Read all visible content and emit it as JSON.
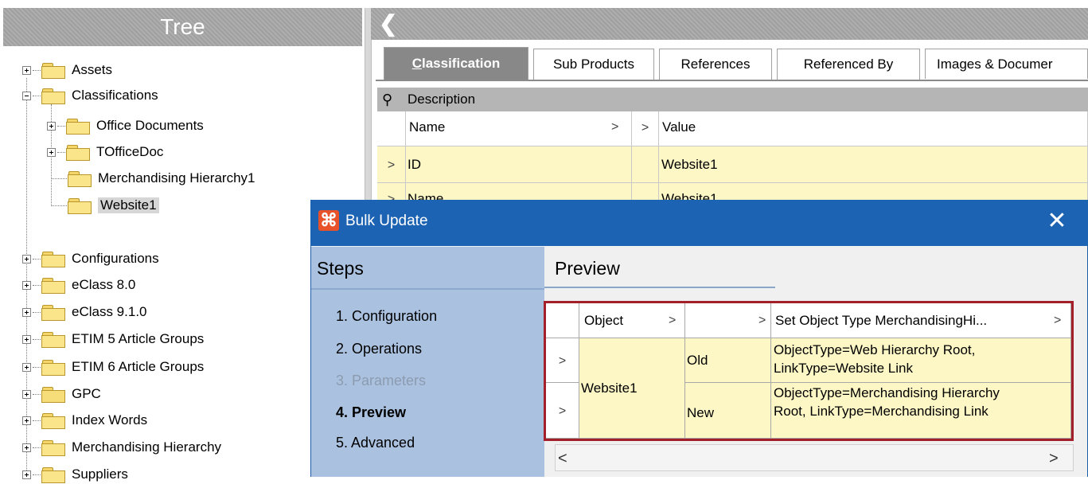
{
  "tree": {
    "header": "Tree",
    "items": [
      {
        "label": "Assets",
        "expander": "+"
      },
      {
        "label": "Classifications",
        "expander": "-"
      },
      {
        "label": "Office Documents",
        "expander": "+"
      },
      {
        "label": "TOfficeDoc",
        "expander": "+"
      },
      {
        "label": "Merchandising Hierarchy1",
        "expander": ""
      },
      {
        "label": "Website1",
        "expander": "",
        "selected": true
      },
      {
        "label": "Configurations",
        "expander": "+"
      },
      {
        "label": "eClass 8.0",
        "expander": "+"
      },
      {
        "label": "eClass 9.1.0",
        "expander": "+"
      },
      {
        "label": "ETIM 5 Article Groups",
        "expander": "+"
      },
      {
        "label": "ETIM 6 Article Groups",
        "expander": "+"
      },
      {
        "label": "GPC",
        "expander": "+"
      },
      {
        "label": "Index Words",
        "expander": "+"
      },
      {
        "label": "Merchandising Hierarchy",
        "expander": "+"
      },
      {
        "label": "Suppliers",
        "expander": "+"
      }
    ]
  },
  "editor": {
    "collapse_glyph": "❮",
    "tabs": [
      {
        "label_first": "C",
        "label_rest": "lassification",
        "active": true
      },
      {
        "label": "Sub Products"
      },
      {
        "label": "References"
      },
      {
        "label": "Referenced By"
      },
      {
        "label": "Images & Documer"
      }
    ],
    "description_label": "Description",
    "pin_glyph": "⚲",
    "grid": {
      "col_name": "Name",
      "col_value": "Value",
      "chevron": ">",
      "rows": [
        {
          "name": "ID",
          "value": "Website1"
        },
        {
          "name": "Name",
          "value": "Website1"
        }
      ]
    }
  },
  "dialog": {
    "title": "Bulk Update",
    "close_glyph": "✕",
    "steps_title": "Steps",
    "steps": [
      {
        "label": "1. Configuration",
        "state": "normal"
      },
      {
        "label": "2. Operations",
        "state": "normal"
      },
      {
        "label": "3. Parameters",
        "state": "disabled"
      },
      {
        "label": "4. Preview",
        "state": "current"
      },
      {
        "label": "5. Advanced",
        "state": "normal"
      }
    ],
    "preview_title": "Preview",
    "preview_grid": {
      "col_object": "Object",
      "col_blank": "",
      "col_operation": "Set Object Type MerchandisingHi...",
      "chevron": ">",
      "object_value": "Website1",
      "rows": [
        {
          "state": "Old",
          "value_line1": "ObjectType=Web Hierarchy Root,",
          "value_line2": "LinkType=Website Link"
        },
        {
          "state": "New",
          "value_line1": "ObjectType=Merchandising Hierarchy",
          "value_line2": "Root, LinkType=Merchandising Link"
        }
      ]
    },
    "scroll_left": "<",
    "scroll_right": ">"
  },
  "colors": {
    "dialog_title_bar": "#1d63b3",
    "steps_panel": "#aac2e0",
    "highlight_border": "#a3202a",
    "cell_yellow": "#fdf7c6",
    "folder": "#fbe58a"
  }
}
